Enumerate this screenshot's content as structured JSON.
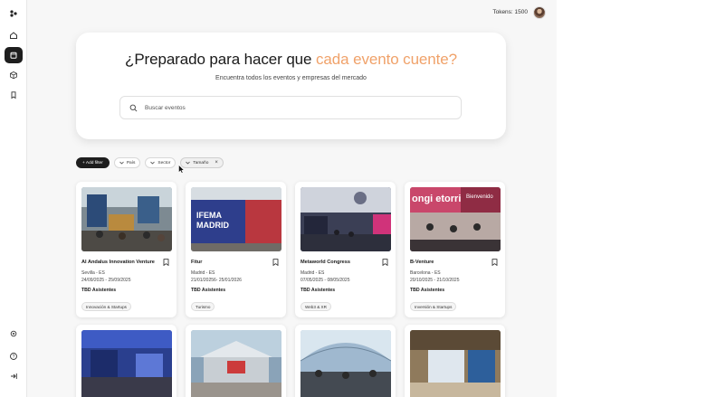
{
  "sidebar": {
    "items": [
      {
        "name": "logo",
        "icon": "logo-icon",
        "active": false
      },
      {
        "name": "home",
        "icon": "home-icon",
        "active": false
      },
      {
        "name": "calendar",
        "icon": "calendar-icon",
        "active": true
      },
      {
        "name": "box",
        "icon": "cube-icon",
        "active": false
      },
      {
        "name": "saved",
        "icon": "bookmark-icon",
        "active": false
      }
    ],
    "bottom": [
      {
        "name": "settings",
        "icon": "gear-icon"
      },
      {
        "name": "help",
        "icon": "help-icon"
      },
      {
        "name": "logout",
        "icon": "logout-icon"
      }
    ]
  },
  "topbar": {
    "tokens_label": "Tokens: 1500"
  },
  "hero": {
    "title_prefix": "¿Preparado para hacer que ",
    "title_accent": "cada evento cuente?",
    "subtitle": "Encuentra todos los eventos y empresas del mercado",
    "search_placeholder": "Buscar eventos",
    "accent_color": "#f0a26a"
  },
  "filters": {
    "add_filter": "+ Add filter",
    "chips": [
      {
        "label": "País",
        "selected": false,
        "removable": false
      },
      {
        "label": "Sector",
        "selected": false,
        "removable": false
      },
      {
        "label": "Tamaño",
        "selected": true,
        "removable": true
      }
    ]
  },
  "events": [
    {
      "name": "AI Andalus Innovation Venture",
      "location": "Sevilla - ES",
      "dates": "24/09/2025 - 25/09/2025",
      "attendees": "TBD Asistentes",
      "tag": "Innovación & Startups"
    },
    {
      "name": "Fitur",
      "location": "Madrid - ES",
      "dates": "21/01/20256- 25/01/2026",
      "attendees": "TBD Asistentes",
      "tag": "Turismo"
    },
    {
      "name": "Metaworld Congress",
      "location": "Madrid - ES",
      "dates": "07/05/2025 - 08/05/2025",
      "attendees": "TBD Asistentes",
      "tag": "Web3 & XR"
    },
    {
      "name": "B-Venture",
      "location": "Barcelona - ES",
      "dates": "20/10/2025 - 21/10/2025",
      "attendees": "TBD Asistentes",
      "tag": "Inversión & Startups"
    }
  ]
}
